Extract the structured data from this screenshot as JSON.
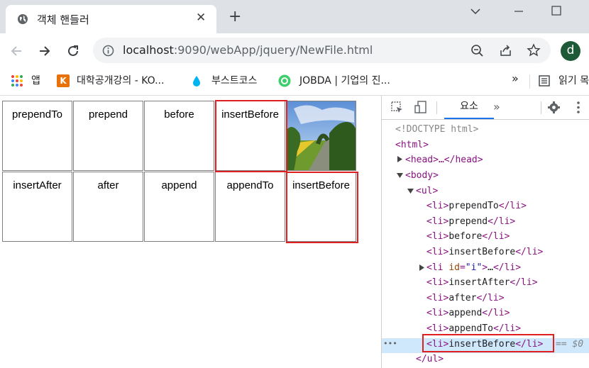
{
  "browser": {
    "tab_title": "객체 핸들러",
    "tab_close": "✕",
    "new_tab": "+",
    "url_host": "localhost",
    "url_rest": ":9090/webApp/jquery/NewFile.html",
    "profile_initial": "d"
  },
  "bookmarks": [
    {
      "label": "앱"
    },
    {
      "label": "대학공개강의 - KO..."
    },
    {
      "label": "부스트코스"
    },
    {
      "label": "JOBDA | 기업의 진..."
    },
    {
      "label": "»"
    },
    {
      "label": "읽기 목"
    }
  ],
  "grid": {
    "row1": [
      "prependTo",
      "prepend",
      "before",
      "insertBefore"
    ],
    "row2": [
      "insertAfter",
      "after",
      "append",
      "appendTo",
      "insertBefore"
    ]
  },
  "devtools": {
    "tab_label": "요소",
    "more": "»",
    "lines": {
      "doctype": "<!DOCTYPE html>",
      "html_open": "<html>",
      "head": "<head>…</head>",
      "body_open": "<body>",
      "ul_open": "<ul>",
      "li1": "prependTo",
      "li2": "prepend",
      "li3": "before",
      "li4": "insertBefore",
      "li_id_attr": "id",
      "li_id_val": "\"i\"",
      "li6": "insertAfter",
      "li7": "after",
      "li8": "append",
      "li9": "appendTo",
      "li10": "insertBefore",
      "ul_close": "</ul>",
      "dollar_ref": "== $0",
      "dots": "•••"
    }
  },
  "colors": {
    "accent": "#1a73e8",
    "highlight_box": "#e02020",
    "tag": "#881280"
  }
}
